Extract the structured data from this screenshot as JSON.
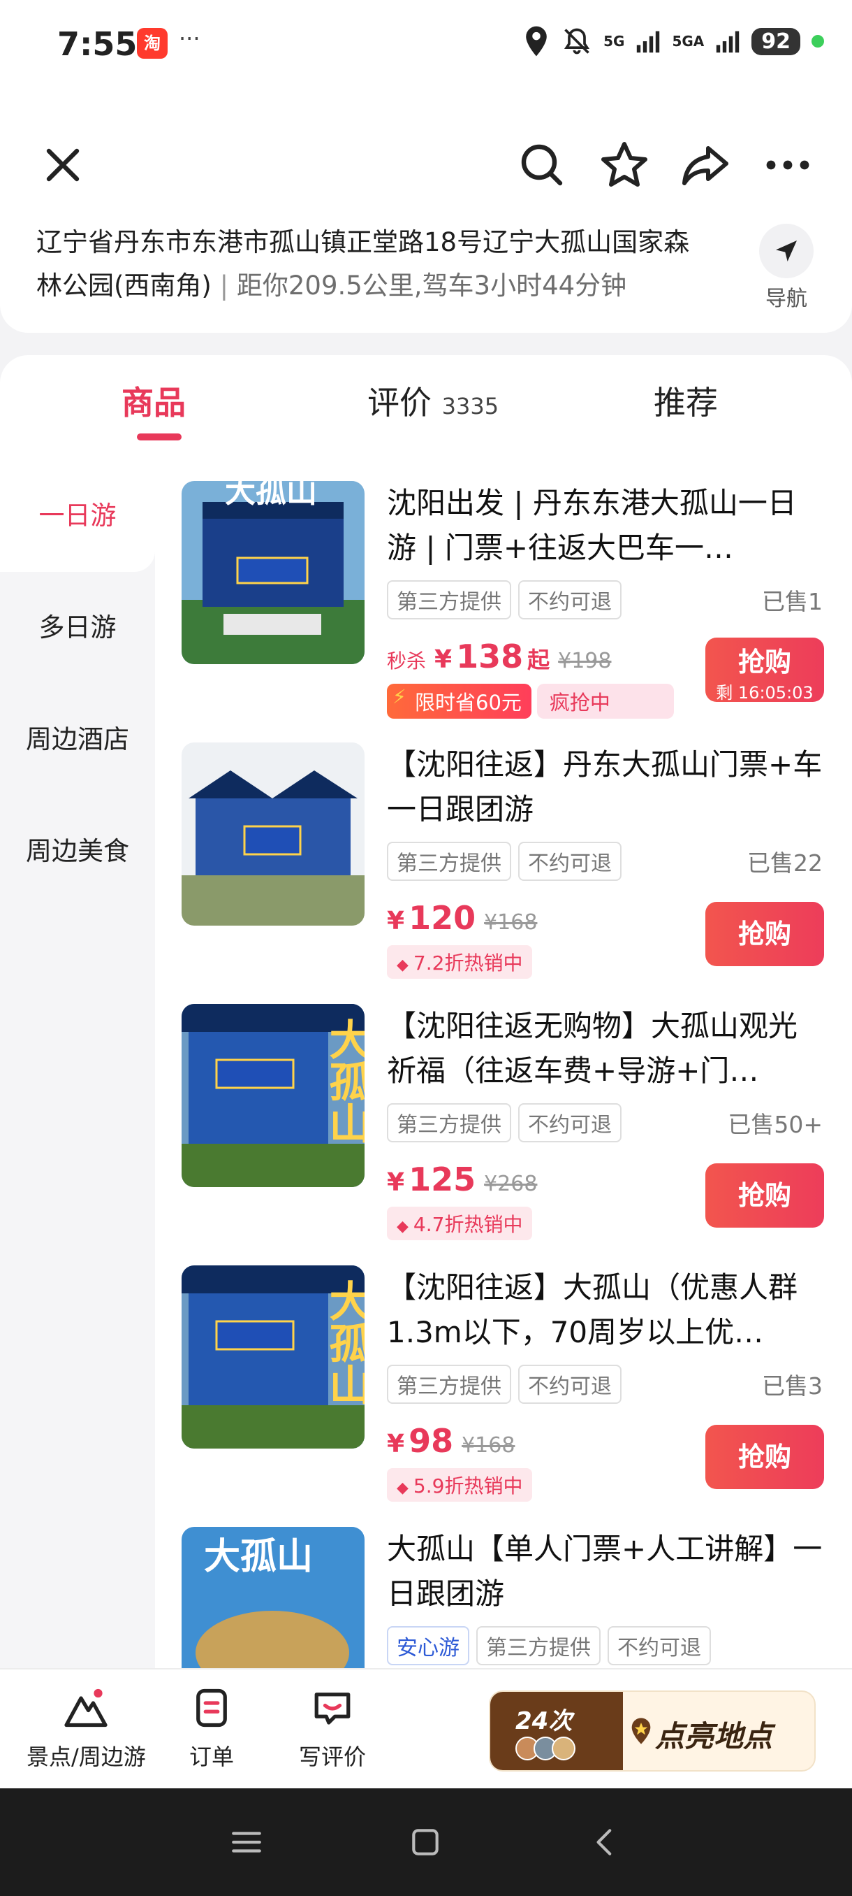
{
  "status_bar": {
    "time": "7:55",
    "app_badge": "淘",
    "more": "···",
    "signal1": "5G",
    "signal2": "5GA",
    "battery": "92"
  },
  "header": {
    "address": "辽宁省丹东市东港市孤山镇正堂路18号辽宁大孤山国家森林公园(西南角)",
    "separator": " | ",
    "distance": "距你209.5公里,驾车3小时44分钟",
    "nav_label": "导航"
  },
  "tabs": [
    {
      "label": "商品",
      "count": ""
    },
    {
      "label": "评价",
      "count": "3335"
    },
    {
      "label": "推荐",
      "count": ""
    }
  ],
  "sidebar": [
    "一日游",
    "多日游",
    "周边酒店",
    "周边美食"
  ],
  "products": [
    {
      "title": "沈阳出发 | 丹东东港大孤山一日游 | 门票+往返大巴车一…",
      "tags": [
        "第三方提供",
        "不约可退"
      ],
      "sold": "已售1",
      "flash": "秒杀",
      "currency": "¥",
      "price": "138",
      "suffix": "起",
      "orig": "¥198",
      "save_badge": "限时省60元",
      "hot_badge": "疯抢中",
      "buy": "抢购",
      "timer": "剩 16:05:03"
    },
    {
      "title": "【沈阳往返】丹东大孤山门票+车一日跟团游",
      "tags": [
        "第三方提供",
        "不约可退"
      ],
      "sold": "已售22",
      "currency": "¥",
      "price": "120",
      "orig": "¥168",
      "disc_badge": "7.2折热销中",
      "buy": "抢购"
    },
    {
      "title": "【沈阳往返无购物】大孤山观光祈福（往返车费+导游+门…",
      "tags": [
        "第三方提供",
        "不约可退"
      ],
      "sold": "已售50+",
      "currency": "¥",
      "price": "125",
      "orig": "¥268",
      "disc_badge": "4.7折热销中",
      "buy": "抢购"
    },
    {
      "title": "【沈阳往返】大孤山（优惠人群1.3m以下，70周岁以上优…",
      "tags": [
        "第三方提供",
        "不约可退"
      ],
      "sold": "已售3",
      "currency": "¥",
      "price": "98",
      "orig": "¥168",
      "disc_badge": "5.9折热销中",
      "buy": "抢购"
    },
    {
      "title": "大孤山【单人门票+人工讲解】一日跟团游",
      "tags": [
        "安心游",
        "第三方提供",
        "不约可退"
      ]
    }
  ],
  "thumb_text": [
    "大孤山",
    "大孤山",
    "大孤山",
    "大孤山",
    "大孤山"
  ],
  "bottom_nav": [
    {
      "label": "景点/周边游"
    },
    {
      "label": "订单"
    },
    {
      "label": "写评价"
    }
  ],
  "checkin": {
    "count": "24次",
    "label": "点亮地点"
  },
  "colors": {
    "accent": "#e8395a",
    "buy_button": "#ef4a55",
    "sidebar_bg": "#f5f5f7"
  }
}
